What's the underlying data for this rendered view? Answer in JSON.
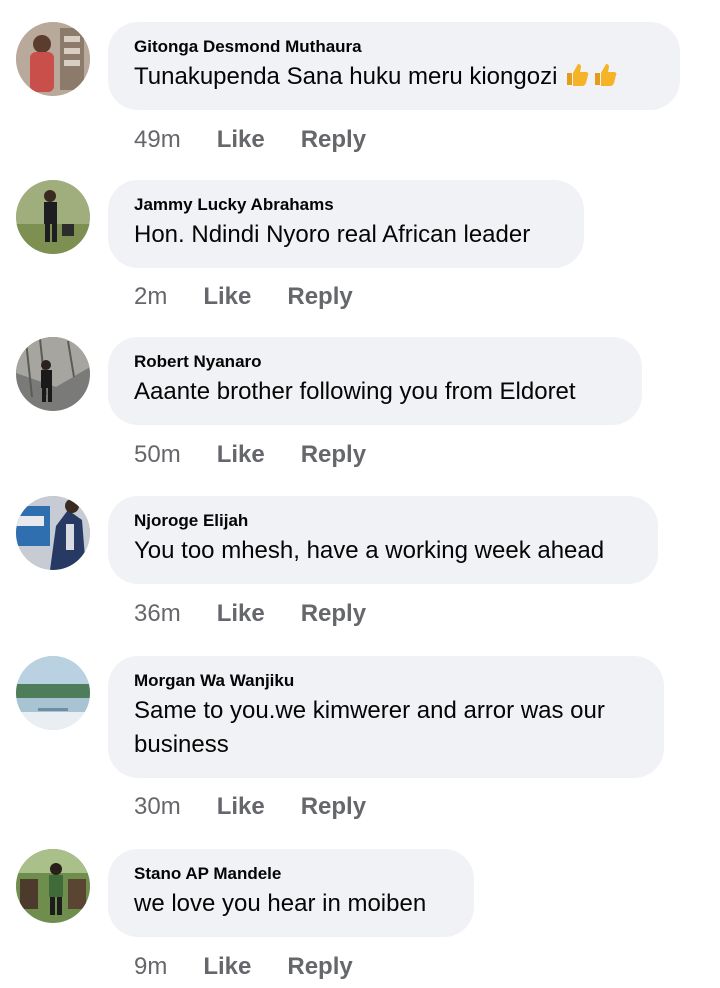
{
  "comments": [
    {
      "author": "Gitonga Desmond Muthaura",
      "text": "Tunakupenda Sana huku meru kiongozi",
      "emoji": [
        "thumbs-up-icon",
        "thumbs-up-icon"
      ],
      "time": "49m",
      "like_label": "Like",
      "reply_label": "Reply"
    },
    {
      "author": "Jammy Lucky Abrahams",
      "text": "Hon. Ndindi Nyoro real African leader",
      "time": "2m",
      "like_label": "Like",
      "reply_label": "Reply"
    },
    {
      "author": "Robert Nyanaro",
      "text": "Aaante brother following you from Eldoret",
      "time": "50m",
      "like_label": "Like",
      "reply_label": "Reply"
    },
    {
      "author": "Njoroge Elijah",
      "text": "You too mhesh, have a working week ahead",
      "time": "36m",
      "like_label": "Like",
      "reply_label": "Reply"
    },
    {
      "author": "Morgan Wa Wanjiku",
      "text": "Same to you.we kimwerer and arror was our business",
      "time": "30m",
      "like_label": "Like",
      "reply_label": "Reply"
    },
    {
      "author": "Stano AP Mandele",
      "text": "we love you hear in moiben",
      "time": "9m",
      "like_label": "Like",
      "reply_label": "Reply"
    }
  ],
  "colors": {
    "bubble": "#f0f2f5",
    "meta_text": "#65676b",
    "body_text": "#050505",
    "emoji": "#f5b428"
  }
}
